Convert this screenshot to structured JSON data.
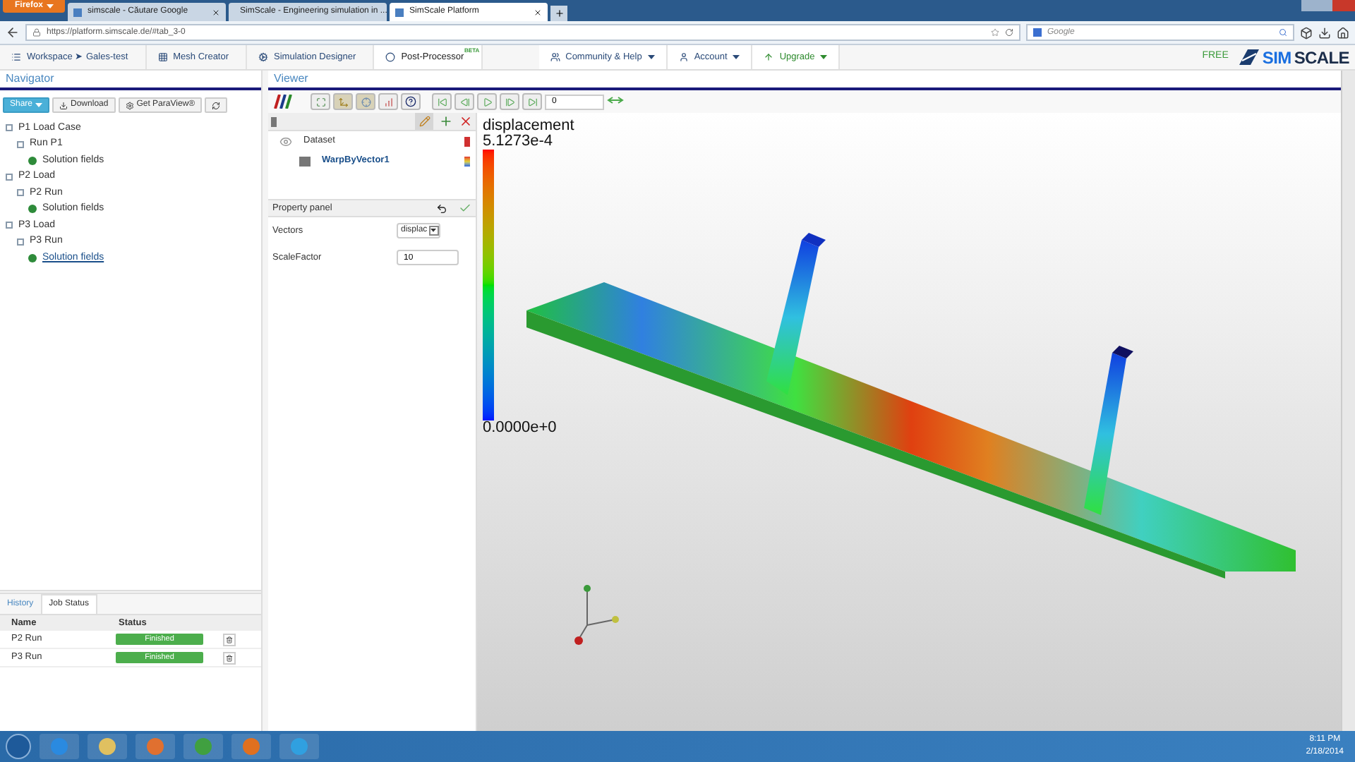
{
  "browser": {
    "menu_button": "Firefox",
    "tabs": [
      {
        "label": "simscale - Căutare Google",
        "selected": false
      },
      {
        "label": "SimScale - Engineering simulation in ...",
        "selected": false
      },
      {
        "label": "SimScale Platform",
        "selected": true
      }
    ],
    "url": "https://platform.simscale.de/#tab_3-0",
    "search_placeholder": "Google"
  },
  "app_nav": {
    "items": [
      {
        "label": "Workspace ➤ Gales-test",
        "selected": false,
        "kind": "list"
      },
      {
        "label": "Mesh Creator",
        "selected": false,
        "kind": "grid"
      },
      {
        "label": "Simulation Designer",
        "selected": false,
        "kind": "gears"
      },
      {
        "label": "Post-Processor",
        "selected": true,
        "kind": "dot",
        "badge": "BETA"
      }
    ],
    "menus": [
      {
        "label": "Community & Help",
        "kind": "users"
      },
      {
        "label": "Account",
        "kind": "user"
      },
      {
        "label": "Upgrade",
        "kind": "up"
      }
    ],
    "plan": "FREE",
    "logo": [
      "SIM",
      "SCALE"
    ]
  },
  "navigator": {
    "title": "Navigator",
    "buttons": [
      {
        "label": "Share",
        "kind": "share"
      },
      {
        "label": "Download",
        "kind": "download"
      },
      {
        "label": "Get ParaView®",
        "kind": "gear"
      },
      {
        "kind": "refresh"
      }
    ],
    "tree": [
      {
        "label": "P1 Load Case",
        "selected": false,
        "children": [
          {
            "label": "Run P1",
            "selected": false,
            "children": [
              {
                "label": "Solution fields",
                "selected": false
              }
            ]
          }
        ]
      },
      {
        "label": "P2 Load",
        "selected": false,
        "children": [
          {
            "label": "P2 Run",
            "selected": false,
            "children": [
              {
                "label": "Solution fields",
                "selected": false
              }
            ]
          }
        ]
      },
      {
        "label": "P3 Load",
        "selected": false,
        "children": [
          {
            "label": "P3 Run",
            "selected": false,
            "children": [
              {
                "label": "Solution fields",
                "selected": true
              }
            ]
          }
        ]
      }
    ]
  },
  "bottom_panel": {
    "tabs": [
      {
        "label": "History",
        "selected": false
      },
      {
        "label": "Job Status",
        "selected": true
      }
    ],
    "columns": [
      "Name",
      "Status"
    ],
    "rows": [
      {
        "name": "P2 Run",
        "status": "Finished"
      },
      {
        "name": "P3 Run",
        "status": "Finished"
      }
    ]
  },
  "viewer": {
    "title": "Viewer",
    "frame": "0",
    "pipeline": [
      {
        "label": "Dataset",
        "selected": false
      },
      {
        "label": "WarpByVector1",
        "selected": true
      }
    ],
    "property_panel": {
      "title": "Property panel",
      "fields": [
        {
          "label": "Vectors",
          "value": "displac",
          "kind": "select"
        },
        {
          "label": "ScaleFactor",
          "value": "10",
          "kind": "input"
        }
      ]
    },
    "legend": {
      "title": "displacement",
      "max": "5.1273e-4",
      "min": "0.0000e+0"
    }
  },
  "taskbar": {
    "time": "8:11 PM",
    "date": "2/18/2014"
  }
}
